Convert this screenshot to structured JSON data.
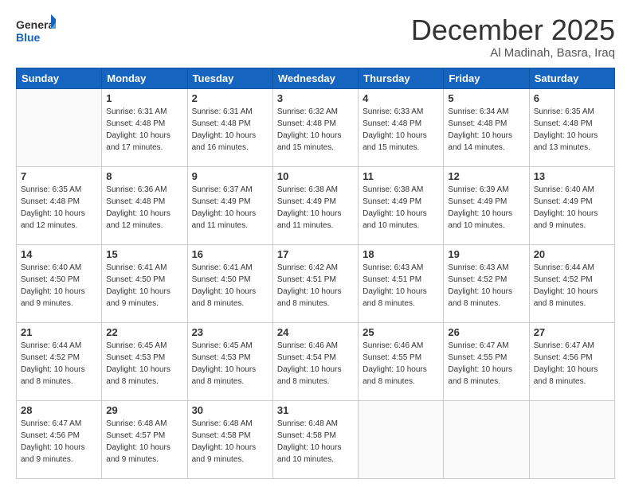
{
  "logo": {
    "general": "General",
    "blue": "Blue"
  },
  "header": {
    "month": "December 2025",
    "location": "Al Madinah, Basra, Iraq"
  },
  "days_of_week": [
    "Sunday",
    "Monday",
    "Tuesday",
    "Wednesday",
    "Thursday",
    "Friday",
    "Saturday"
  ],
  "weeks": [
    [
      {
        "day": "",
        "info": ""
      },
      {
        "day": "1",
        "info": "Sunrise: 6:31 AM\nSunset: 4:48 PM\nDaylight: 10 hours\nand 17 minutes."
      },
      {
        "day": "2",
        "info": "Sunrise: 6:31 AM\nSunset: 4:48 PM\nDaylight: 10 hours\nand 16 minutes."
      },
      {
        "day": "3",
        "info": "Sunrise: 6:32 AM\nSunset: 4:48 PM\nDaylight: 10 hours\nand 15 minutes."
      },
      {
        "day": "4",
        "info": "Sunrise: 6:33 AM\nSunset: 4:48 PM\nDaylight: 10 hours\nand 15 minutes."
      },
      {
        "day": "5",
        "info": "Sunrise: 6:34 AM\nSunset: 4:48 PM\nDaylight: 10 hours\nand 14 minutes."
      },
      {
        "day": "6",
        "info": "Sunrise: 6:35 AM\nSunset: 4:48 PM\nDaylight: 10 hours\nand 13 minutes."
      }
    ],
    [
      {
        "day": "7",
        "info": "Sunrise: 6:35 AM\nSunset: 4:48 PM\nDaylight: 10 hours\nand 12 minutes."
      },
      {
        "day": "8",
        "info": "Sunrise: 6:36 AM\nSunset: 4:48 PM\nDaylight: 10 hours\nand 12 minutes."
      },
      {
        "day": "9",
        "info": "Sunrise: 6:37 AM\nSunset: 4:49 PM\nDaylight: 10 hours\nand 11 minutes."
      },
      {
        "day": "10",
        "info": "Sunrise: 6:38 AM\nSunset: 4:49 PM\nDaylight: 10 hours\nand 11 minutes."
      },
      {
        "day": "11",
        "info": "Sunrise: 6:38 AM\nSunset: 4:49 PM\nDaylight: 10 hours\nand 10 minutes."
      },
      {
        "day": "12",
        "info": "Sunrise: 6:39 AM\nSunset: 4:49 PM\nDaylight: 10 hours\nand 10 minutes."
      },
      {
        "day": "13",
        "info": "Sunrise: 6:40 AM\nSunset: 4:49 PM\nDaylight: 10 hours\nand 9 minutes."
      }
    ],
    [
      {
        "day": "14",
        "info": "Sunrise: 6:40 AM\nSunset: 4:50 PM\nDaylight: 10 hours\nand 9 minutes."
      },
      {
        "day": "15",
        "info": "Sunrise: 6:41 AM\nSunset: 4:50 PM\nDaylight: 10 hours\nand 9 minutes."
      },
      {
        "day": "16",
        "info": "Sunrise: 6:41 AM\nSunset: 4:50 PM\nDaylight: 10 hours\nand 8 minutes."
      },
      {
        "day": "17",
        "info": "Sunrise: 6:42 AM\nSunset: 4:51 PM\nDaylight: 10 hours\nand 8 minutes."
      },
      {
        "day": "18",
        "info": "Sunrise: 6:43 AM\nSunset: 4:51 PM\nDaylight: 10 hours\nand 8 minutes."
      },
      {
        "day": "19",
        "info": "Sunrise: 6:43 AM\nSunset: 4:52 PM\nDaylight: 10 hours\nand 8 minutes."
      },
      {
        "day": "20",
        "info": "Sunrise: 6:44 AM\nSunset: 4:52 PM\nDaylight: 10 hours\nand 8 minutes."
      }
    ],
    [
      {
        "day": "21",
        "info": "Sunrise: 6:44 AM\nSunset: 4:52 PM\nDaylight: 10 hours\nand 8 minutes."
      },
      {
        "day": "22",
        "info": "Sunrise: 6:45 AM\nSunset: 4:53 PM\nDaylight: 10 hours\nand 8 minutes."
      },
      {
        "day": "23",
        "info": "Sunrise: 6:45 AM\nSunset: 4:53 PM\nDaylight: 10 hours\nand 8 minutes."
      },
      {
        "day": "24",
        "info": "Sunrise: 6:46 AM\nSunset: 4:54 PM\nDaylight: 10 hours\nand 8 minutes."
      },
      {
        "day": "25",
        "info": "Sunrise: 6:46 AM\nSunset: 4:55 PM\nDaylight: 10 hours\nand 8 minutes."
      },
      {
        "day": "26",
        "info": "Sunrise: 6:47 AM\nSunset: 4:55 PM\nDaylight: 10 hours\nand 8 minutes."
      },
      {
        "day": "27",
        "info": "Sunrise: 6:47 AM\nSunset: 4:56 PM\nDaylight: 10 hours\nand 8 minutes."
      }
    ],
    [
      {
        "day": "28",
        "info": "Sunrise: 6:47 AM\nSunset: 4:56 PM\nDaylight: 10 hours\nand 9 minutes."
      },
      {
        "day": "29",
        "info": "Sunrise: 6:48 AM\nSunset: 4:57 PM\nDaylight: 10 hours\nand 9 minutes."
      },
      {
        "day": "30",
        "info": "Sunrise: 6:48 AM\nSunset: 4:58 PM\nDaylight: 10 hours\nand 9 minutes."
      },
      {
        "day": "31",
        "info": "Sunrise: 6:48 AM\nSunset: 4:58 PM\nDaylight: 10 hours\nand 10 minutes."
      },
      {
        "day": "",
        "info": ""
      },
      {
        "day": "",
        "info": ""
      },
      {
        "day": "",
        "info": ""
      }
    ]
  ]
}
